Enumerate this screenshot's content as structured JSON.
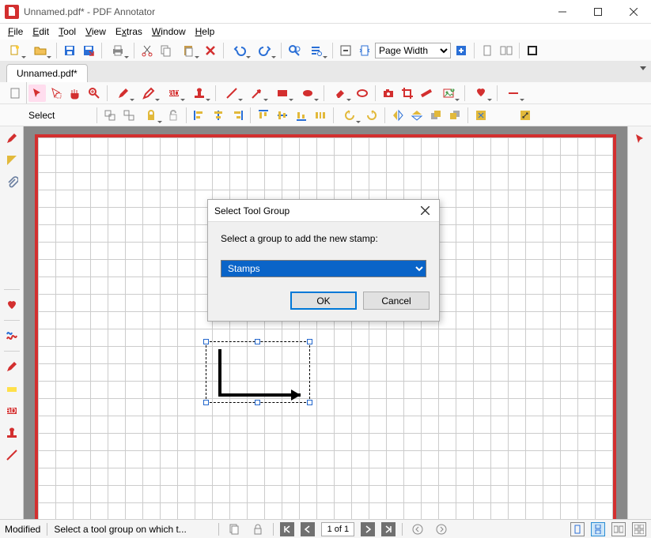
{
  "window": {
    "title": "Unnamed.pdf* - PDF Annotator"
  },
  "menu": {
    "file": "File",
    "edit": "Edit",
    "tool": "Tool",
    "view": "View",
    "extras": "Extras",
    "window": "Window",
    "help": "Help"
  },
  "toolbar1": {
    "zoom_mode": "Page Width"
  },
  "doctab": {
    "label": "Unnamed.pdf*"
  },
  "tools": {
    "mode_label": "Select"
  },
  "dialog": {
    "title": "Select Tool Group",
    "prompt": "Select a group to add the new stamp:",
    "selected": "Stamps",
    "options": [
      "Stamps"
    ],
    "ok": "OK",
    "cancel": "Cancel"
  },
  "status": {
    "modified": "Modified",
    "hint": "Select a tool group on which t...",
    "page": "1 of 1"
  }
}
